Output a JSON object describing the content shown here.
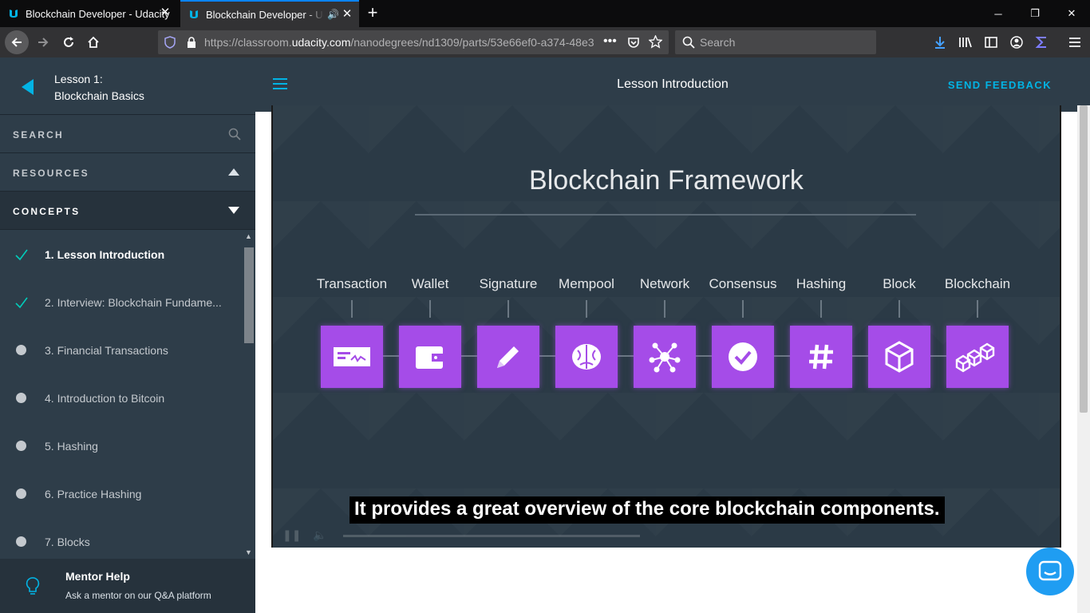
{
  "browser": {
    "tabs": [
      {
        "title": "Blockchain Developer - Udacity",
        "active": false
      },
      {
        "title": "Blockchain Developer - Udacity",
        "active": true
      }
    ],
    "url_prefix": "https://classroom.",
    "url_domain": "udacity.com",
    "url_rest": "/nanodegrees/nd1309/parts/53e66ef0-a374-48e3",
    "search_placeholder": "Search"
  },
  "sidebar": {
    "lesson_number": "Lesson 1:",
    "lesson_name": "Blockchain Basics",
    "search_label": "SEARCH",
    "resources_label": "RESOURCES",
    "concepts_label": "CONCEPTS",
    "concepts": [
      {
        "label": "1. Lesson Introduction",
        "status": "done",
        "active": true
      },
      {
        "label": "2. Interview: Blockchain Fundame...",
        "status": "done",
        "active": false
      },
      {
        "label": "3. Financial Transactions",
        "status": "todo",
        "active": false
      },
      {
        "label": "4. Introduction to Bitcoin",
        "status": "todo",
        "active": false
      },
      {
        "label": "5. Hashing",
        "status": "todo",
        "active": false
      },
      {
        "label": "6. Practice Hashing",
        "status": "todo",
        "active": false
      },
      {
        "label": "7. Blocks",
        "status": "todo",
        "active": false
      }
    ],
    "mentor_title": "Mentor Help",
    "mentor_subtitle": "Ask a mentor on our Q&A platform"
  },
  "main": {
    "title": "Lesson Introduction",
    "feedback_label": "SEND FEEDBACK"
  },
  "video": {
    "slide_title": "Blockchain Framework",
    "components": [
      {
        "label": "Transaction",
        "icon": "check-payment-icon"
      },
      {
        "label": "Wallet",
        "icon": "wallet-icon"
      },
      {
        "label": "Signature",
        "icon": "pencil-icon"
      },
      {
        "label": "Mempool",
        "icon": "brain-icon"
      },
      {
        "label": "Network",
        "icon": "network-nodes-icon"
      },
      {
        "label": "Consensus",
        "icon": "checkmark-circle-icon"
      },
      {
        "label": "Hashing",
        "icon": "hash-icon"
      },
      {
        "label": "Block",
        "icon": "cube-icon"
      },
      {
        "label": "Blockchain",
        "icon": "cubes-chain-icon"
      }
    ],
    "caption": "It provides a great overview of the core blockchain components."
  },
  "colors": {
    "accent": "#02b3e4",
    "sidebar_bg": "#2e3d49",
    "component_box": "#a54ce8",
    "chat_button": "#1f9df2"
  }
}
